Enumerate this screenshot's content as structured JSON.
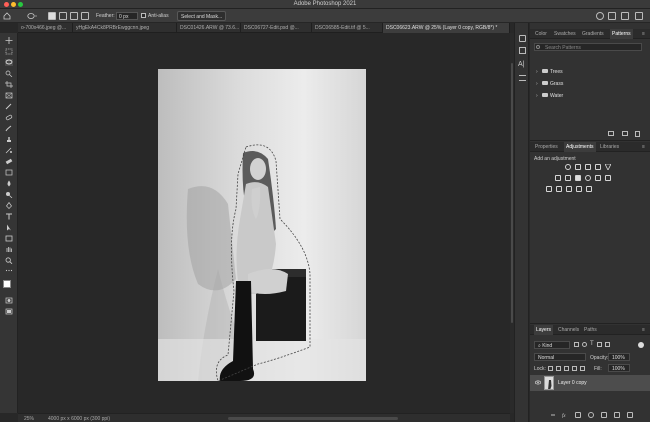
{
  "window": {
    "title": "Adobe Photoshop 2021"
  },
  "options_bar": {
    "feather_label": "Feather:",
    "feather_value": "0 px",
    "antialias_label": "Anti-alias",
    "select_mask_label": "Select and Mask..."
  },
  "tabs": [
    {
      "label": "o-700x466.jpeg @..."
    },
    {
      "label": "yHgEkA4Ck8PRBrEwggcnn.jpeg"
    },
    {
      "label": "DSC01426.ARW @ 73.6..."
    },
    {
      "label": "DSC06727-Edit.psd @..."
    },
    {
      "label": "DSC06585-Edit.tif @ 5..."
    },
    {
      "label": "DSC06623.ARW @ 25% (Layer 0 copy, RGB/8*) *"
    }
  ],
  "status": {
    "zoom": "25%",
    "doc_info": "4000 px x 6000 px (300 ppi)"
  },
  "patterns_panel": {
    "tabs": [
      "Color",
      "Swatches",
      "Gradients",
      "Patterns"
    ],
    "active_tab": "Patterns",
    "search_placeholder": "Search Patterns",
    "folders": [
      "Trees",
      "Grass",
      "Water"
    ]
  },
  "adjustments_panel": {
    "tabs": [
      "Properties",
      "Adjustments",
      "Libraries"
    ],
    "active_tab": "Adjustments",
    "add_label": "Add an adjustment"
  },
  "layers_panel": {
    "tabs": [
      "Layers",
      "Channels",
      "Paths"
    ],
    "active_tab": "Layers",
    "kind_label": "Kind",
    "blend_mode": "Normal",
    "opacity_label": "Opacity:",
    "opacity_value": "100%",
    "lock_label": "Lock:",
    "fill_label": "Fill:",
    "fill_value": "100%",
    "layer_name": "Layer 0 copy"
  },
  "colors": {
    "accent_selection": "#4d4d4d",
    "panel_bg": "#323232"
  }
}
